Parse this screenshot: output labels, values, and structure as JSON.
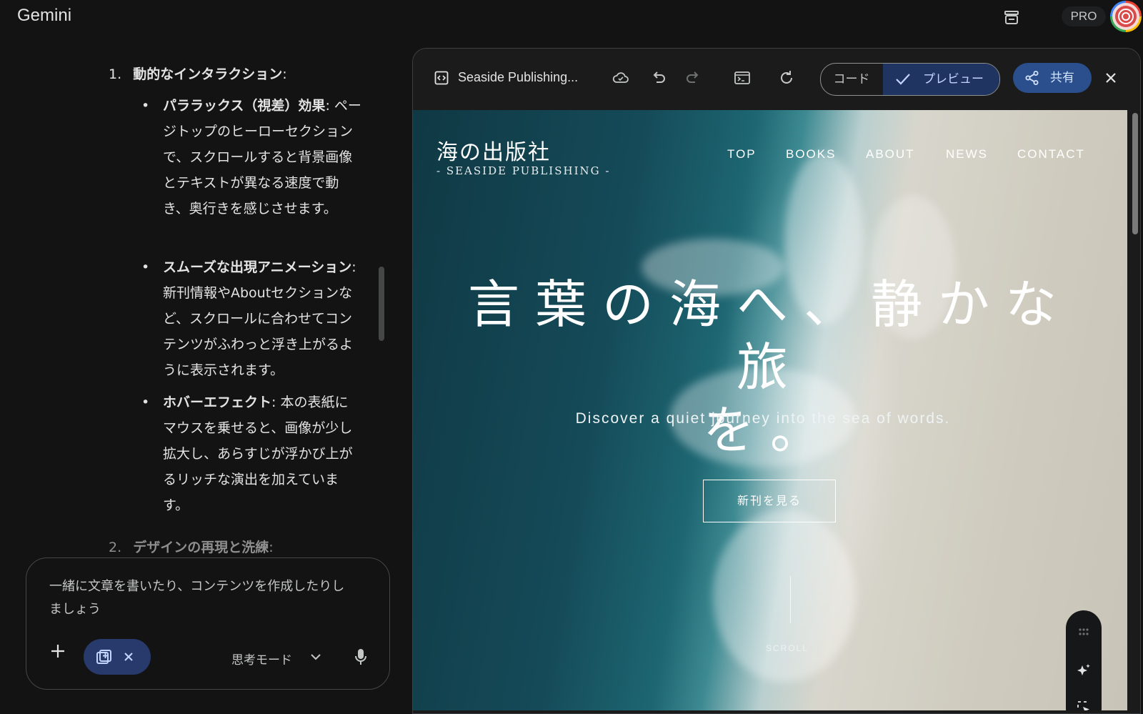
{
  "app": {
    "title": "Gemini",
    "plan_badge": "PRO"
  },
  "chat": {
    "item1": {
      "number": "1.",
      "title": "動的なインタラクション",
      "colon": ":"
    },
    "bullets": [
      {
        "title": "パララックス（視差）効果",
        "text": ": ページトップのヒーローセクションで、スクロールすると背景画像とテキストが異なる速度で動き、奥行きを感じさせます。"
      },
      {
        "title": "スムーズな出現アニメーション",
        "text": ": 新刊情報やAboutセクションなど、スクロールに合わせてコンテンツがふわっと浮き上がるように表示されます。"
      },
      {
        "title": "ホバーエフェクト",
        "text": ": 本の表紙にマウスを乗せると、画像が少し拡大し、あらすじが浮かび上がるリッチな演出を加えています。"
      }
    ],
    "item2": {
      "number": "2.",
      "title": "デザインの再現と洗練",
      "colon": ":"
    }
  },
  "composer": {
    "placeholder": "一緒に文章を書いたり、コンテンツを作成したりしましょう",
    "mode_label": "思考モード"
  },
  "canvas": {
    "doc_title": "Seaside Publishing...",
    "toggle": {
      "code": "コード",
      "preview": "プレビュー",
      "selected": "preview"
    },
    "share_label": "共有"
  },
  "preview_site": {
    "logo_jp": "海の出版社",
    "logo_en": "- SEASIDE PUBLISHING -",
    "nav": [
      "TOP",
      "BOOKS",
      "ABOUT",
      "NEWS",
      "CONTACT"
    ],
    "hero_line1": "言葉の海へ、静かな旅",
    "hero_line2": "を。",
    "subtitle": "Discover a quiet journey into the sea of words.",
    "cta": "新刊を見る",
    "scroll_label": "SCROLL"
  },
  "colors": {
    "accent_blue": "#2a4f8c",
    "toggle_selected": "#1f3460",
    "chip": "#28396b"
  }
}
